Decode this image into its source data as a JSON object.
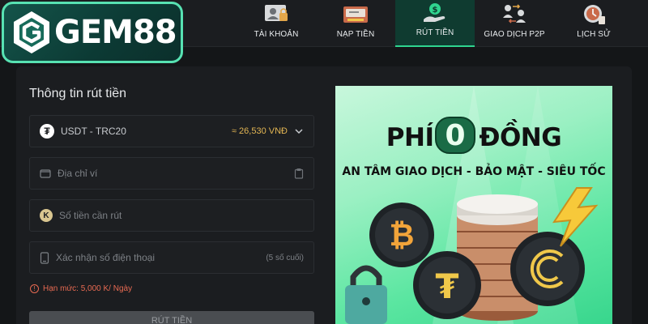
{
  "brand": {
    "name": "GEM88"
  },
  "nav": {
    "items": [
      {
        "label": "TÀI KHOẢN",
        "icon": "account-icon",
        "active": false
      },
      {
        "label": "NẠP TIỀN",
        "icon": "deposit-icon",
        "active": false
      },
      {
        "label": "RÚT TIỀN",
        "icon": "withdraw-icon",
        "active": true
      },
      {
        "label": "GIAO DỊCH P2P",
        "icon": "p2p-icon",
        "active": false
      },
      {
        "label": "LỊCH SỬ",
        "icon": "history-icon",
        "active": false
      }
    ]
  },
  "form": {
    "title": "Thông tin rút tiền",
    "currency": {
      "label": "USDT - TRC20",
      "rate": "≈ 26,530 VNĐ"
    },
    "wallet_placeholder": "Địa chỉ ví",
    "amount_placeholder": "Số tiền cần rút",
    "phone_placeholder": "Xác nhận số điện thoại",
    "phone_hint": "(5 số cuối)",
    "limit_text": "Hạn mức: 5,000 K/ Ngày",
    "submit_label": "RÚT TIỀN"
  },
  "banner": {
    "title_pre": "PHÍ",
    "title_zero": "0",
    "title_post": "ĐỒNG",
    "subtitle": "AN TÂM GIAO DỊCH - BẢO MẬT - SIÊU TỐC"
  },
  "colors": {
    "accent": "#2fd58f",
    "logo_border": "#57e2b2",
    "warning": "#e86a52",
    "rate": "#e2b553",
    "background": "#141618"
  }
}
